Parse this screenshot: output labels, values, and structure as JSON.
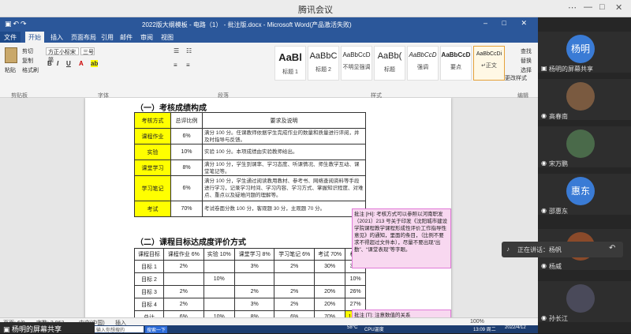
{
  "meeting": {
    "title": "腾讯会议",
    "controls": [
      "⋯",
      "—",
      "□",
      "✕"
    ]
  },
  "word": {
    "doc_title": "2022版大纲模板 - 电路（1） - 批注版.docx  -  Microsoft Word(产品激活失败)",
    "tabs": [
      "文件",
      "开始",
      "插入",
      "页面布局",
      "引用",
      "邮件",
      "审阅",
      "视图"
    ],
    "ribbon": {
      "clipboard_label": "剪贴板",
      "paste": "粘贴",
      "cut": "剪切",
      "copy": "复制",
      "format_painter": "格式刷",
      "font_name": "方正小标宋简",
      "font_size": "三号",
      "font_group": "字体",
      "paragraph_group": "段落",
      "styles_group": "样式",
      "edit_group": "编辑",
      "styles": [
        {
          "preview": "AaBl",
          "name": "标题 1"
        },
        {
          "preview": "AaBbC",
          "name": "标题 2"
        },
        {
          "preview": "AaBbCcD",
          "name": "不明显强调"
        },
        {
          "preview": "AaBb(",
          "name": "标题"
        },
        {
          "preview": "AaBbCcD",
          "name": "强调"
        },
        {
          "preview": "AaBbCcD",
          "name": "要点"
        },
        {
          "preview": "AaBbCcDi",
          "name": "↵正文"
        }
      ],
      "change_styles": "更改样式",
      "find": "查找",
      "replace": "替换",
      "select": "选择"
    },
    "status": {
      "page": "页面: 6/9",
      "words": "字数: 3,862",
      "lang": "中文(中国)",
      "insert": "插入",
      "zoom": "100%"
    }
  },
  "doc": {
    "sec1": "（一）考核成绩构成",
    "t1_head": [
      "考核方式",
      "总评比例",
      "要求及说明"
    ],
    "t1_rows": [
      {
        "way": "课程作业",
        "ratio": "6%",
        "desc": "满分 100 分。任课教师依据学生完成作业的数量和质量进行评阅，并及时指导与反馈。"
      },
      {
        "way": "实验",
        "ratio": "10%",
        "desc": "实验 100 分。本项成绩由实验教师给出。"
      },
      {
        "way": "课堂学习",
        "ratio": "8%",
        "desc": "满分 100 分，学生到课率、学习态度、听课情况、师生教学互动、课堂笔记等。"
      },
      {
        "way": "学习笔记",
        "ratio": "6%",
        "desc": "满分 100 分，学生通过阅读教用教材、参考书、网络查阅资料等手段进行学习，记录学习时间、学习内容、学习方式、掌握知识程度、对难点、重点以及疑难问题的理解等。"
      },
      {
        "way": "考试",
        "ratio": "70%",
        "desc": "考试卷面分数 100 分，客观题 30 分，主观题 70 分。"
      }
    ],
    "sec2": "（二）课程目标达成度评价方式",
    "t2_head": [
      "课程目标",
      "课程作业 6%",
      "实验 10%",
      "课堂学习 8%",
      "学习笔记 6%",
      "考试 70%",
      "权重"
    ],
    "t2_rows": [
      [
        "目标 1",
        "2%",
        "",
        "3%",
        "2%",
        "30%",
        "37%"
      ],
      [
        "目标 2",
        "",
        "10%",
        "",
        "",
        "",
        "10%"
      ],
      [
        "目标 3",
        "2%",
        "",
        "2%",
        "2%",
        "20%",
        "26%"
      ],
      [
        "目标 4",
        "2%",
        "",
        "3%",
        "2%",
        "20%",
        "27%"
      ],
      [
        "总计",
        "6%",
        "10%",
        "8%",
        "6%",
        "70%",
        "100%"
      ]
    ],
    "comment1": "批注 [Hi]: 考核方式可以参照以河南职发（2021）213 号关于印发《沈阳城市建设学院课程教学课程形成性评价工作指导性意见》的通知，里面的条目，（比例不要求不得超过文件本），尽量不要出现“出勤”、“课堂表现”等字眼。",
    "comment2": "批注 [T]: 注意数值的关系"
  },
  "taskbar": {
    "search": "输入你想搜的",
    "search_btn": "搜索一下",
    "temp": "58°C",
    "cpu": "CPU温度",
    "time": "13:09 周二",
    "date": "2022/4/12"
  },
  "participants": [
    {
      "name": "杨明的屏幕共享",
      "avatar": "杨明",
      "color": "#3a7bd5"
    },
    {
      "name": "高春南",
      "avatar": "",
      "color": "#7a5a40"
    },
    {
      "name": "宋万鹏",
      "avatar": "",
      "color": "#4a6a4a"
    },
    {
      "name": "邵惠东",
      "avatar": "惠东",
      "color": "#3a7bd5"
    },
    {
      "name": "杨威",
      "avatar": "",
      "color": "#8a4a2a"
    },
    {
      "name": "孙长江",
      "avatar": "",
      "color": "#4a4a5a"
    }
  ],
  "speaking": "正在讲话：杨帆",
  "share_label": "杨明的屏幕共享"
}
